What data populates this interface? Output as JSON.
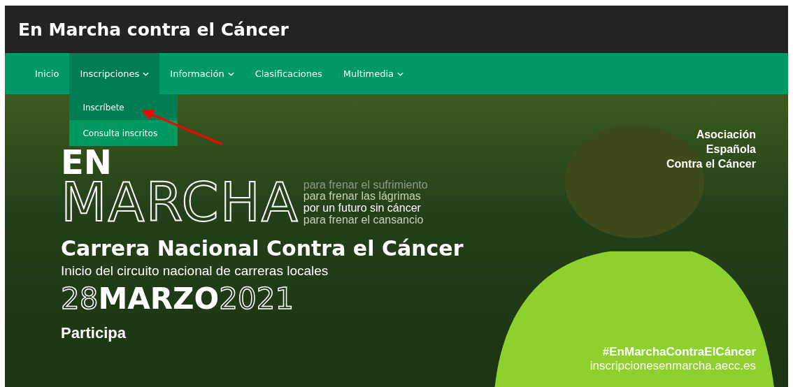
{
  "site_title": "En Marcha contra el Cáncer",
  "nav": [
    {
      "label": "Inicio",
      "has_submenu": false,
      "selected": false
    },
    {
      "label": "Inscripciones",
      "has_submenu": true,
      "selected": true,
      "submenu": [
        {
          "label": "Inscríbete",
          "selected": true
        },
        {
          "label": "Consulta inscritos",
          "selected": false
        }
      ]
    },
    {
      "label": "Información",
      "has_submenu": true,
      "selected": false
    },
    {
      "label": "Clasificaciones",
      "has_submenu": false,
      "selected": false
    },
    {
      "label": "Multimedia",
      "has_submenu": true,
      "selected": false
    }
  ],
  "banner": {
    "logo_top": "EN",
    "logo_word": "MARCHA",
    "taglines": [
      {
        "text": "para frenar el sufrimiento",
        "kind": "faded"
      },
      {
        "text": "para frenar las lágrimas",
        "kind": "dim"
      },
      {
        "text": "por un futuro sin cáncer",
        "kind": "bright"
      },
      {
        "text": "para frenar el cansancio",
        "kind": "dim"
      }
    ],
    "title": "Carrera Nacional Contra el Cáncer",
    "subtitle": "Inicio del circuito nacional de carreras locales",
    "date": [
      {
        "text": "28",
        "kind": "outline"
      },
      {
        "text": "MARZO",
        "kind": "solid"
      },
      {
        "text": "2021",
        "kind": "outline"
      }
    ],
    "cta": "Participa",
    "organization": [
      "Asociación",
      "Española",
      "Contra el Cáncer"
    ],
    "hashtag": "#EnMarchaContraElCáncer",
    "url": "inscripcionesenmarcha.aecc.es"
  }
}
